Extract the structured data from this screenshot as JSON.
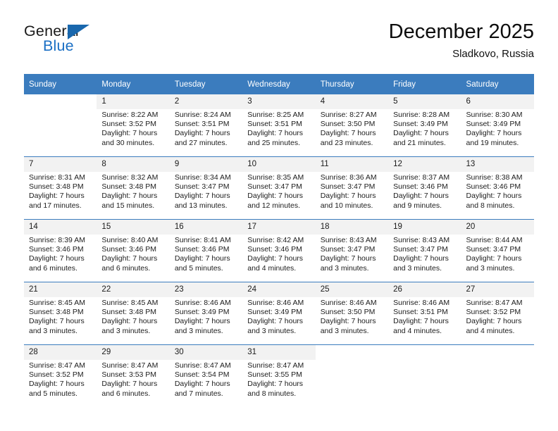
{
  "brand": {
    "name_top": "General",
    "name_bottom": "Blue",
    "accent_color": "#1967ad",
    "logo_icon": "triangle-logo-icon"
  },
  "header": {
    "month_title": "December 2025",
    "location": "Sladkovo, Russia"
  },
  "theme": {
    "header_bg": "#3b7cbe",
    "header_text": "#ffffff",
    "daynum_bg": "#f2f2f2",
    "grid_line": "#3b7cbe",
    "page_bg": "#ffffff"
  },
  "calendar": {
    "weekday_headers": [
      "Sunday",
      "Monday",
      "Tuesday",
      "Wednesday",
      "Thursday",
      "Friday",
      "Saturday"
    ],
    "weeks": [
      [
        {
          "day": "",
          "blank": true,
          "sunrise": "",
          "sunset": "",
          "daylight1": "",
          "daylight2": ""
        },
        {
          "day": "1",
          "sunrise": "Sunrise: 8:22 AM",
          "sunset": "Sunset: 3:52 PM",
          "daylight1": "Daylight: 7 hours",
          "daylight2": "and 30 minutes."
        },
        {
          "day": "2",
          "sunrise": "Sunrise: 8:24 AM",
          "sunset": "Sunset: 3:51 PM",
          "daylight1": "Daylight: 7 hours",
          "daylight2": "and 27 minutes."
        },
        {
          "day": "3",
          "sunrise": "Sunrise: 8:25 AM",
          "sunset": "Sunset: 3:51 PM",
          "daylight1": "Daylight: 7 hours",
          "daylight2": "and 25 minutes."
        },
        {
          "day": "4",
          "sunrise": "Sunrise: 8:27 AM",
          "sunset": "Sunset: 3:50 PM",
          "daylight1": "Daylight: 7 hours",
          "daylight2": "and 23 minutes."
        },
        {
          "day": "5",
          "sunrise": "Sunrise: 8:28 AM",
          "sunset": "Sunset: 3:49 PM",
          "daylight1": "Daylight: 7 hours",
          "daylight2": "and 21 minutes."
        },
        {
          "day": "6",
          "sunrise": "Sunrise: 8:30 AM",
          "sunset": "Sunset: 3:49 PM",
          "daylight1": "Daylight: 7 hours",
          "daylight2": "and 19 minutes."
        }
      ],
      [
        {
          "day": "7",
          "sunrise": "Sunrise: 8:31 AM",
          "sunset": "Sunset: 3:48 PM",
          "daylight1": "Daylight: 7 hours",
          "daylight2": "and 17 minutes."
        },
        {
          "day": "8",
          "sunrise": "Sunrise: 8:32 AM",
          "sunset": "Sunset: 3:48 PM",
          "daylight1": "Daylight: 7 hours",
          "daylight2": "and 15 minutes."
        },
        {
          "day": "9",
          "sunrise": "Sunrise: 8:34 AM",
          "sunset": "Sunset: 3:47 PM",
          "daylight1": "Daylight: 7 hours",
          "daylight2": "and 13 minutes."
        },
        {
          "day": "10",
          "sunrise": "Sunrise: 8:35 AM",
          "sunset": "Sunset: 3:47 PM",
          "daylight1": "Daylight: 7 hours",
          "daylight2": "and 12 minutes."
        },
        {
          "day": "11",
          "sunrise": "Sunrise: 8:36 AM",
          "sunset": "Sunset: 3:47 PM",
          "daylight1": "Daylight: 7 hours",
          "daylight2": "and 10 minutes."
        },
        {
          "day": "12",
          "sunrise": "Sunrise: 8:37 AM",
          "sunset": "Sunset: 3:46 PM",
          "daylight1": "Daylight: 7 hours",
          "daylight2": "and 9 minutes."
        },
        {
          "day": "13",
          "sunrise": "Sunrise: 8:38 AM",
          "sunset": "Sunset: 3:46 PM",
          "daylight1": "Daylight: 7 hours",
          "daylight2": "and 8 minutes."
        }
      ],
      [
        {
          "day": "14",
          "sunrise": "Sunrise: 8:39 AM",
          "sunset": "Sunset: 3:46 PM",
          "daylight1": "Daylight: 7 hours",
          "daylight2": "and 6 minutes."
        },
        {
          "day": "15",
          "sunrise": "Sunrise: 8:40 AM",
          "sunset": "Sunset: 3:46 PM",
          "daylight1": "Daylight: 7 hours",
          "daylight2": "and 6 minutes."
        },
        {
          "day": "16",
          "sunrise": "Sunrise: 8:41 AM",
          "sunset": "Sunset: 3:46 PM",
          "daylight1": "Daylight: 7 hours",
          "daylight2": "and 5 minutes."
        },
        {
          "day": "17",
          "sunrise": "Sunrise: 8:42 AM",
          "sunset": "Sunset: 3:46 PM",
          "daylight1": "Daylight: 7 hours",
          "daylight2": "and 4 minutes."
        },
        {
          "day": "18",
          "sunrise": "Sunrise: 8:43 AM",
          "sunset": "Sunset: 3:47 PM",
          "daylight1": "Daylight: 7 hours",
          "daylight2": "and 3 minutes."
        },
        {
          "day": "19",
          "sunrise": "Sunrise: 8:43 AM",
          "sunset": "Sunset: 3:47 PM",
          "daylight1": "Daylight: 7 hours",
          "daylight2": "and 3 minutes."
        },
        {
          "day": "20",
          "sunrise": "Sunrise: 8:44 AM",
          "sunset": "Sunset: 3:47 PM",
          "daylight1": "Daylight: 7 hours",
          "daylight2": "and 3 minutes."
        }
      ],
      [
        {
          "day": "21",
          "sunrise": "Sunrise: 8:45 AM",
          "sunset": "Sunset: 3:48 PM",
          "daylight1": "Daylight: 7 hours",
          "daylight2": "and 3 minutes."
        },
        {
          "day": "22",
          "sunrise": "Sunrise: 8:45 AM",
          "sunset": "Sunset: 3:48 PM",
          "daylight1": "Daylight: 7 hours",
          "daylight2": "and 3 minutes."
        },
        {
          "day": "23",
          "sunrise": "Sunrise: 8:46 AM",
          "sunset": "Sunset: 3:49 PM",
          "daylight1": "Daylight: 7 hours",
          "daylight2": "and 3 minutes."
        },
        {
          "day": "24",
          "sunrise": "Sunrise: 8:46 AM",
          "sunset": "Sunset: 3:49 PM",
          "daylight1": "Daylight: 7 hours",
          "daylight2": "and 3 minutes."
        },
        {
          "day": "25",
          "sunrise": "Sunrise: 8:46 AM",
          "sunset": "Sunset: 3:50 PM",
          "daylight1": "Daylight: 7 hours",
          "daylight2": "and 3 minutes."
        },
        {
          "day": "26",
          "sunrise": "Sunrise: 8:46 AM",
          "sunset": "Sunset: 3:51 PM",
          "daylight1": "Daylight: 7 hours",
          "daylight2": "and 4 minutes."
        },
        {
          "day": "27",
          "sunrise": "Sunrise: 8:47 AM",
          "sunset": "Sunset: 3:52 PM",
          "daylight1": "Daylight: 7 hours",
          "daylight2": "and 4 minutes."
        }
      ],
      [
        {
          "day": "28",
          "sunrise": "Sunrise: 8:47 AM",
          "sunset": "Sunset: 3:52 PM",
          "daylight1": "Daylight: 7 hours",
          "daylight2": "and 5 minutes."
        },
        {
          "day": "29",
          "sunrise": "Sunrise: 8:47 AM",
          "sunset": "Sunset: 3:53 PM",
          "daylight1": "Daylight: 7 hours",
          "daylight2": "and 6 minutes."
        },
        {
          "day": "30",
          "sunrise": "Sunrise: 8:47 AM",
          "sunset": "Sunset: 3:54 PM",
          "daylight1": "Daylight: 7 hours",
          "daylight2": "and 7 minutes."
        },
        {
          "day": "31",
          "sunrise": "Sunrise: 8:47 AM",
          "sunset": "Sunset: 3:55 PM",
          "daylight1": "Daylight: 7 hours",
          "daylight2": "and 8 minutes."
        },
        {
          "day": "",
          "blank": true,
          "sunrise": "",
          "sunset": "",
          "daylight1": "",
          "daylight2": ""
        },
        {
          "day": "",
          "blank": true,
          "sunrise": "",
          "sunset": "",
          "daylight1": "",
          "daylight2": ""
        },
        {
          "day": "",
          "blank": true,
          "sunrise": "",
          "sunset": "",
          "daylight1": "",
          "daylight2": ""
        }
      ]
    ]
  }
}
